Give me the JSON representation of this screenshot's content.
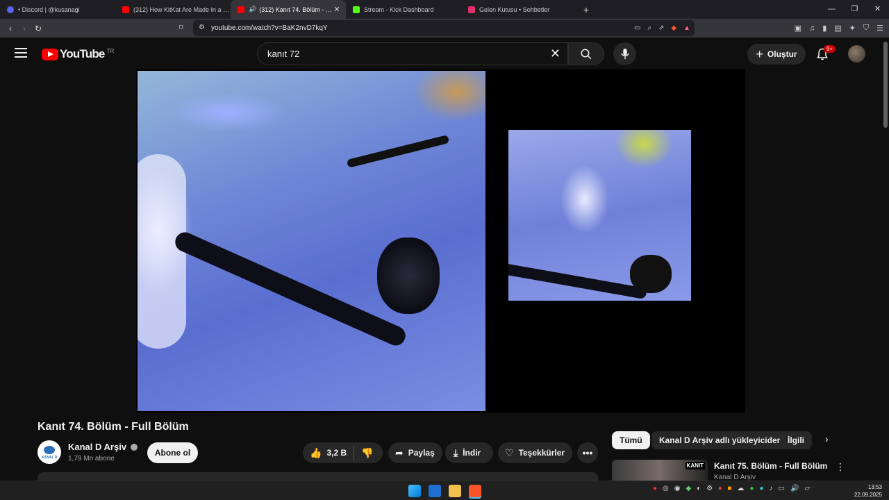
{
  "browser": {
    "tabs": [
      {
        "title": "• Discord | @kusanagi",
        "active": false,
        "color": "#5865f2"
      },
      {
        "title": "(312) How KitKat Are Made In a Facto",
        "active": false,
        "color": "#ff0000"
      },
      {
        "title": "(312) Kanıt 74. Bölüm - Full Bö",
        "active": true,
        "color": "#ff0000"
      },
      {
        "title": "Stream - Kick Dashboard",
        "active": false,
        "color": "#53fc18"
      },
      {
        "title": "Gelen Kutusu • Sohbetler",
        "active": false,
        "color": "#e1306c"
      }
    ],
    "url": "youtube.com/watch?v=BaK2nvD7kqY"
  },
  "youtube": {
    "logo_text": "YouTube",
    "country_code": "TR",
    "search_query": "kanıt 72",
    "create_label": "Oluştur",
    "notification_count": "9+"
  },
  "video": {
    "title": "Kanıt 74. Bölüm - Full Bölüm",
    "channel": "Kanal D Arşiv",
    "channel_logo_text": "KANAL D",
    "subscribers": "1,79 Mn abone",
    "subscribe_label": "Abone ol",
    "likes": "3,2 B",
    "share_label": "Paylaş",
    "download_label": "İndir",
    "thanks_label": "Teşekkürler"
  },
  "sidebar": {
    "chips": [
      "Tümü",
      "Kanal D Arşiv adlı yükleyiciden",
      "İlgili"
    ],
    "recommendation": {
      "title": "Kanıt 75. Bölüm - Full Bölüm",
      "channel": "Kanal D Arşiv",
      "thumb_badge": "KANIT"
    }
  },
  "taskbar": {
    "time": "13:53",
    "date": "22.09.2025"
  }
}
